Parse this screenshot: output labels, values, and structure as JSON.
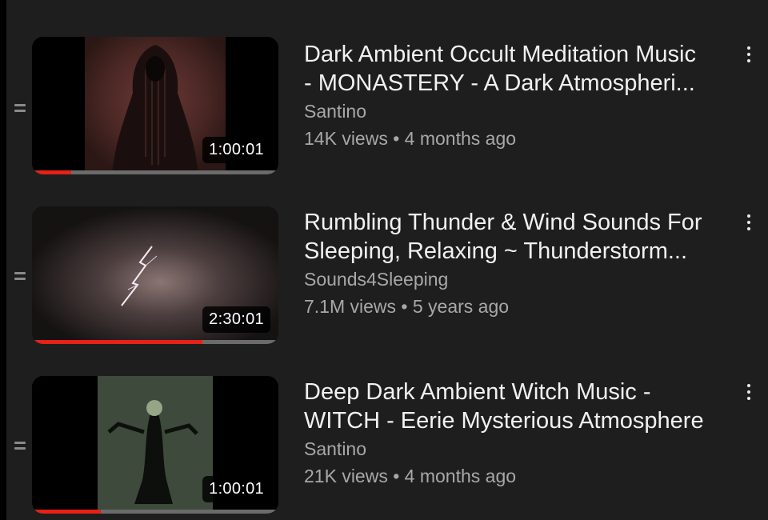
{
  "playlist": {
    "items": [
      {
        "title_line1": "Dark Ambient Occult Meditation Music",
        "title_line2": "- MONASTERY - A Dark Atmospheri...",
        "channel": "Santino",
        "meta": "14K views • 4 months ago",
        "duration": "1:00:01",
        "watched_fraction": 0.16
      },
      {
        "title_line1": "Rumbling Thunder & Wind Sounds For",
        "title_line2": "Sleeping, Relaxing ~ Thunderstorm...",
        "channel": "Sounds4Sleeping",
        "meta": "7.1M views • 5 years ago",
        "duration": "2:30:01",
        "watched_fraction": 0.69
      },
      {
        "title_line1": "Deep Dark Ambient Witch Music -",
        "title_line2": "WITCH - Eerie Mysterious Atmosphere",
        "channel": "Santino",
        "meta": "21K views • 4 months ago",
        "duration": "1:00:01",
        "watched_fraction": 0.28
      }
    ]
  },
  "colors": {
    "background": "#1e1e1e",
    "title": "#f1f1f1",
    "secondary_text": "#a8a8a8",
    "progress": "#e62117"
  }
}
